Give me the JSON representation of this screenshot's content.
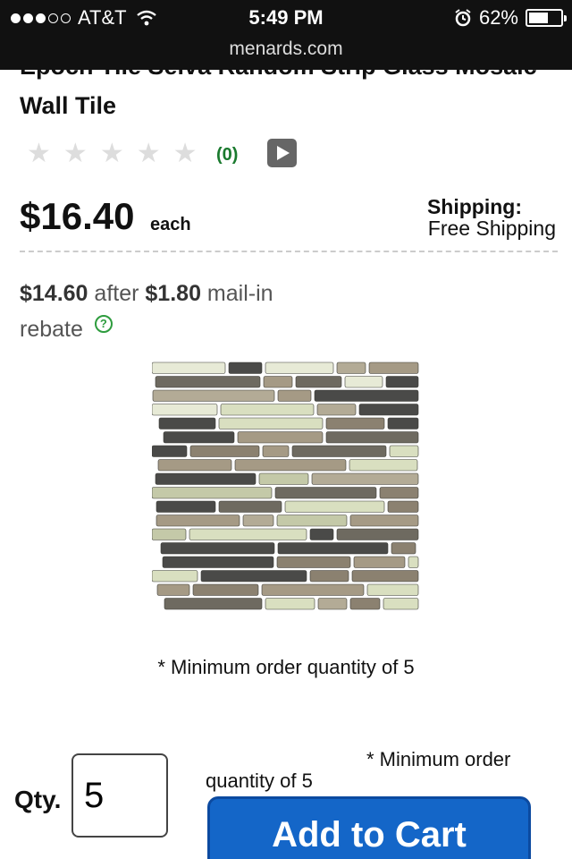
{
  "status_bar": {
    "carrier": "AT&T",
    "time": "5:49 PM",
    "battery": "62%",
    "battery_level": 0.62,
    "icons": [
      "signal-dots-icon",
      "wifi-icon",
      "alarm-clock-icon",
      "battery-icon"
    ]
  },
  "browser": {
    "url": "menards.com"
  },
  "product": {
    "title": "Epoch Tile Selva Random Strip Glass Mosaic Wall Tile",
    "rating": {
      "stars": 0,
      "max": 5,
      "count_label": "(0)"
    },
    "price": "$16.40",
    "unit": "each",
    "shipping_label": "Shipping:",
    "shipping_value": "Free Shipping",
    "rebate": {
      "price": "$14.60",
      "after": "after",
      "amount": "$1.80",
      "text": "mail-in rebate"
    },
    "min_order_note": "* Minimum order quantity of 5",
    "min_order_note_line1": "* Minimum order",
    "min_order_note_line2": "quantity of 5"
  },
  "cart": {
    "qty_label": "Qty.",
    "qty_value": "5",
    "add_button": "Add to Cart"
  },
  "colors": {
    "status_bg": "#111111",
    "button_blue": "#1466c8",
    "review_green": "#1a7a2e"
  }
}
